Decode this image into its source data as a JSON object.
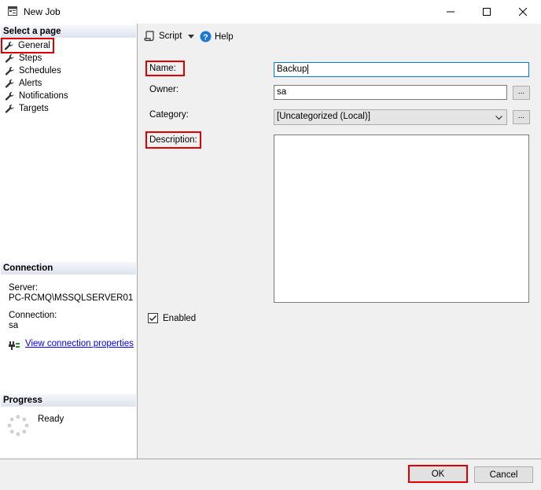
{
  "window": {
    "title": "New Job",
    "minimize_glyph": "—",
    "maximize_glyph": "☐",
    "close_glyph": "✕"
  },
  "left": {
    "select_page_header": "Select a page",
    "pages": [
      {
        "label": "General",
        "icon": "wrench-icon"
      },
      {
        "label": "Steps",
        "icon": "wrench-icon"
      },
      {
        "label": "Schedules",
        "icon": "wrench-icon"
      },
      {
        "label": "Alerts",
        "icon": "wrench-icon"
      },
      {
        "label": "Notifications",
        "icon": "wrench-icon"
      },
      {
        "label": "Targets",
        "icon": "wrench-icon"
      }
    ],
    "connection_header": "Connection",
    "server_label": "Server:",
    "server_value": "PC-RCMQ\\MSSQLSERVER01",
    "connection_label": "Connection:",
    "connection_value": "sa",
    "view_connection_link": "View connection properties",
    "progress_header": "Progress",
    "progress_status": "Ready"
  },
  "toolbar": {
    "script_label": "Script",
    "help_label": "Help"
  },
  "form": {
    "name_label": "Name:",
    "name_value": "Backup",
    "owner_label": "Owner:",
    "owner_value": "sa",
    "category_label": "Category:",
    "category_value": "[Uncategorized (Local)]",
    "description_label": "Description:",
    "description_value": "",
    "browse_glyph": "...",
    "enabled_label": "Enabled",
    "enabled_checked": true
  },
  "buttons": {
    "ok_label": "OK",
    "cancel_label": "Cancel"
  },
  "colors": {
    "highlight": "#e00000",
    "link": "#0000ff",
    "help_icon": "#1e78d2"
  }
}
